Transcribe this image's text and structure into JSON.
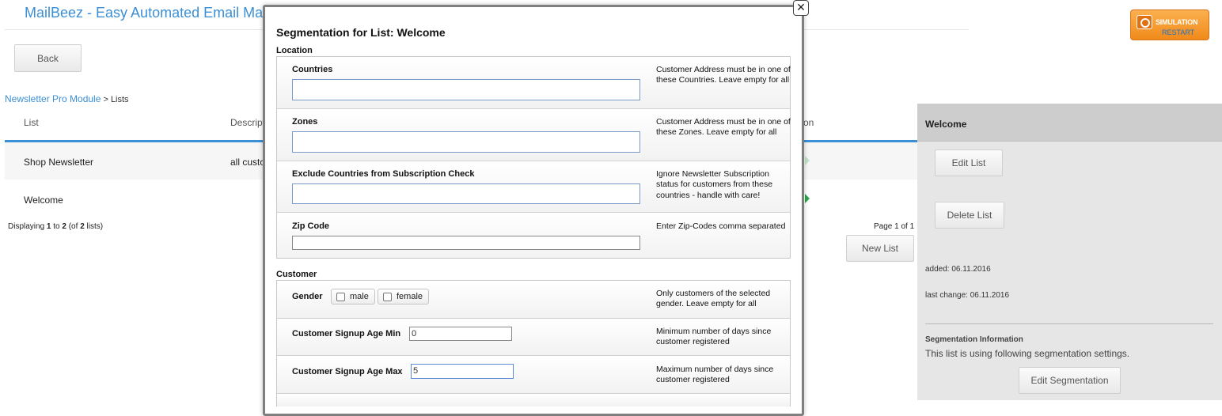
{
  "app": {
    "title": "MailBeez - Easy Automated Email Marketing"
  },
  "toolbar": {
    "back_label": "Back"
  },
  "simulation": {
    "line1": "SIMULATION",
    "line2": "RESTART"
  },
  "breadcrumb": {
    "link": "Newsletter Pro Module",
    "separator": " > ",
    "current": "Lists"
  },
  "table": {
    "columns": [
      "List",
      "Description",
      "Action"
    ],
    "rows": [
      {
        "list": "Shop Newsletter",
        "description": "all customers"
      },
      {
        "list": "Welcome",
        "description": ""
      }
    ]
  },
  "pagination": {
    "prefix": "Displaying ",
    "from": "1",
    "to_label": " to ",
    "to": "2",
    "of_label": " (of ",
    "total": "2",
    "suffix": " lists)",
    "page_text": "Page 1 of 1"
  },
  "actions": {
    "new_list": "New List"
  },
  "side_panel": {
    "title": "Welcome",
    "edit_list": "Edit List",
    "delete_list": "Delete List",
    "added": "added: 06.11.2016",
    "last_change": "last change: 06.11.2016",
    "seg_title": "Segmentation Information",
    "seg_text": "This list is using following segmentation settings.",
    "edit_segmentation": "Edit Segmentation"
  },
  "modal": {
    "close_glyph": "✕",
    "title": "Segmentation for List: Welcome",
    "location": {
      "label": "Location",
      "fields": [
        {
          "label": "Countries",
          "help": "Customer Address must be in one of these Countries. Leave empty for all",
          "value": ""
        },
        {
          "label": "Zones",
          "help": "Customer Address must be in one of these Zones. Leave empty for all",
          "value": ""
        },
        {
          "label": "Exclude Countries from Subscription Check",
          "help": "Ignore Newsletter Subscription status for customers from these countries - handle with care!",
          "value": ""
        },
        {
          "label": "Zip Code",
          "help": "Enter Zip-Codes comma separated",
          "value": ""
        }
      ]
    },
    "customer": {
      "label": "Customer",
      "gender": {
        "label": "Gender",
        "options": [
          "male",
          "female"
        ],
        "help": "Only customers of the selected gender. Leave empty for all"
      },
      "age_min": {
        "label": "Customer Signup Age Min",
        "value": "0",
        "help": "Minimum number of days since customer registered"
      },
      "age_max": {
        "label": "Customer Signup Age Max",
        "value": "5",
        "help": "Maximum number of days since customer registered"
      }
    }
  },
  "colors": {
    "accent": "#3b8fd6",
    "simulation": "#f7a039",
    "action_arrow": "#2aa64a"
  }
}
